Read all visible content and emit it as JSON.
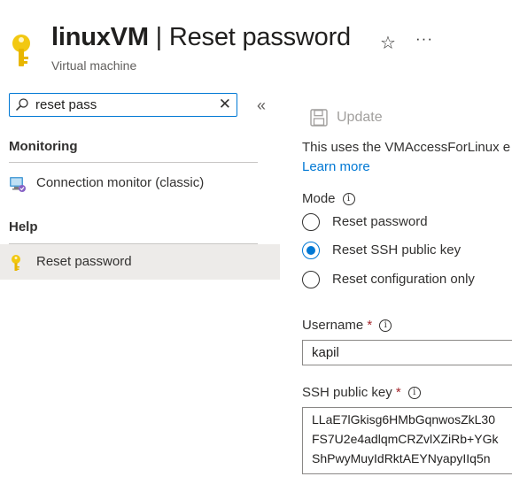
{
  "header": {
    "resource_name": "linuxVM",
    "separator": "|",
    "blade_title": "Reset password",
    "subtitle": "Virtual machine",
    "icons": [
      "key-icon",
      "star-icon",
      "more-icon"
    ]
  },
  "menu": {
    "search": {
      "value": "reset pass",
      "placeholder": ""
    },
    "sections": [
      {
        "header": "Monitoring",
        "items": [
          {
            "label": "Connection monitor (classic)",
            "icon": "connection-monitor-icon",
            "selected": false
          }
        ]
      },
      {
        "header": "Help",
        "items": [
          {
            "label": "Reset password",
            "icon": "key-icon",
            "selected": true
          }
        ]
      }
    ]
  },
  "toolbar": {
    "update_label": "Update",
    "update_enabled": false
  },
  "content": {
    "description": "This uses the VMAccessForLinux e",
    "learn_more": "Learn more",
    "mode": {
      "label": "Mode",
      "options": [
        "Reset password",
        "Reset SSH public key",
        "Reset configuration only"
      ],
      "selected": "Reset SSH public key"
    },
    "username": {
      "label": "Username",
      "required_mark": "*",
      "value": "kapil"
    },
    "ssh_key": {
      "label": "SSH public key",
      "required_mark": "*",
      "lines": [
        "LLaE7lGkisg6HMbGqnwosZkL30",
        "FS7U2e4adlqmCRZvlXZiRb+YGk",
        "ShPwyMuyIdRktAEYNyapyIIq5n"
      ]
    }
  },
  "colors": {
    "accent": "#0078d4",
    "required": "#a4262c",
    "selected_bg": "#edebe9",
    "disabled": "#a19f9d"
  }
}
